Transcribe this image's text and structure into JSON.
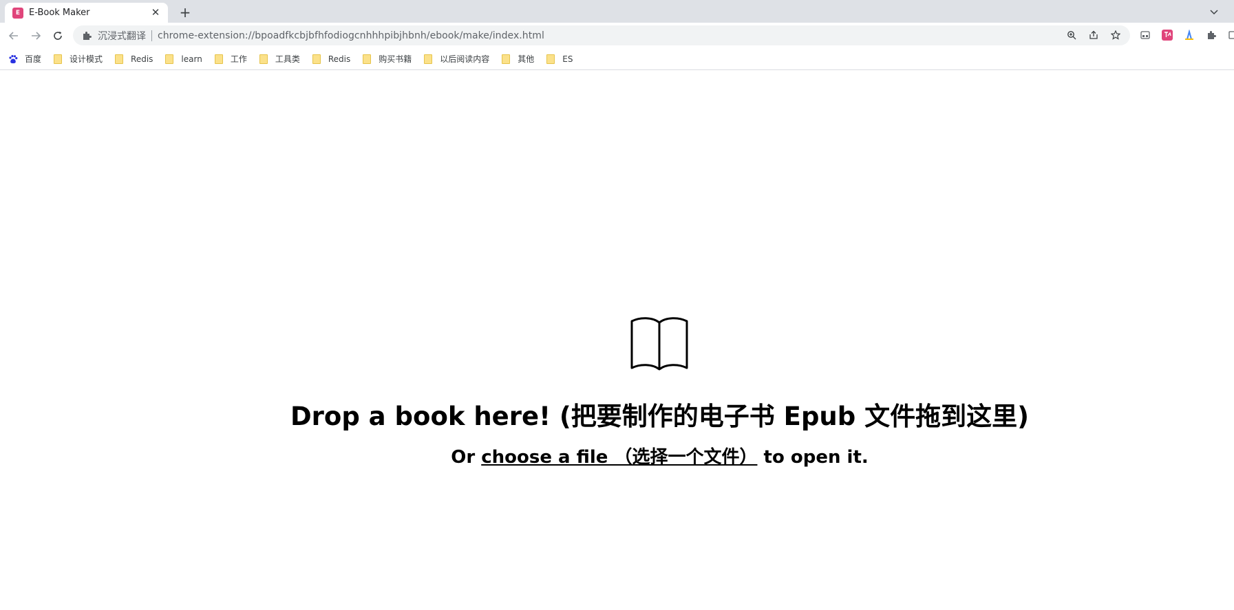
{
  "browser": {
    "tab": {
      "favicon_text": "E",
      "title": "E-Book Maker",
      "close_glyph": "✕",
      "favicon_color": "#e0457b"
    },
    "new_tab_glyph": "+",
    "omnibox": {
      "chip_label": "沉浸式翻译",
      "url": "chrome-extension://bpoadfkcbjbfhfodiogcnhhhpibjhbnh/ebook/make/index.html"
    },
    "icons": {
      "back": "back-arrow-icon",
      "forward": "forward-arrow-icon",
      "reload": "reload-icon",
      "zoom": "zoom-icon",
      "share": "share-icon",
      "bookmark": "star-icon",
      "extensions": [
        "media-icon",
        "translate-extension-icon",
        "color-extension-icon",
        "puzzle-icon",
        "side-panel-icon"
      ]
    }
  },
  "bookmarks": [
    {
      "label": "百度",
      "icon": "baidu-paw-icon"
    },
    {
      "label": "设计模式",
      "icon": "folder-icon"
    },
    {
      "label": "Redis",
      "icon": "folder-icon"
    },
    {
      "label": "learn",
      "icon": "folder-icon"
    },
    {
      "label": "工作",
      "icon": "folder-icon"
    },
    {
      "label": "工具类",
      "icon": "folder-icon"
    },
    {
      "label": "Redis",
      "icon": "folder-icon"
    },
    {
      "label": "购买书籍",
      "icon": "folder-icon"
    },
    {
      "label": "以后阅读内容",
      "icon": "folder-icon"
    },
    {
      "label": "其他",
      "icon": "folder-icon"
    },
    {
      "label": "ES",
      "icon": "folder-icon"
    }
  ],
  "main": {
    "icon": "open-book-icon",
    "title": "Drop a book here! (把要制作的电子书 Epub 文件拖到这里)",
    "sub_prefix": "Or ",
    "sub_link": "choose a file （选择一个文件）",
    "sub_suffix": " to open it."
  }
}
